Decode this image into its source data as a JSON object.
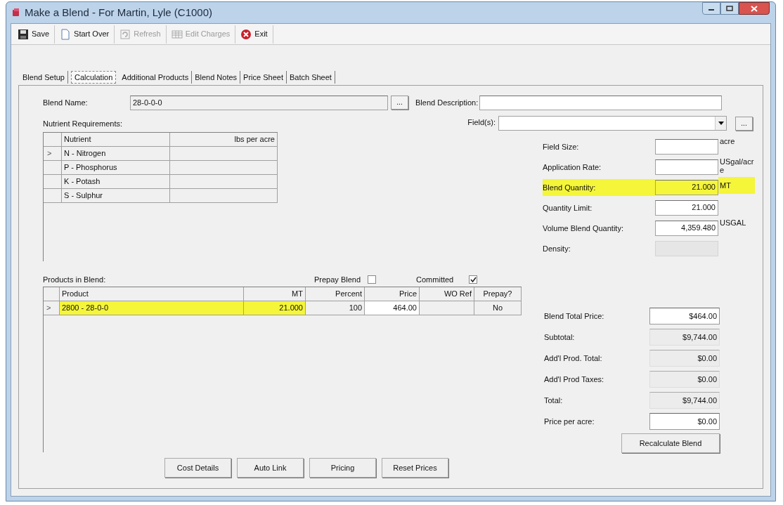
{
  "window": {
    "title": "Make a Blend - For Martin, Lyle (C1000)"
  },
  "toolbar": [
    {
      "kind": "save",
      "label": "Save",
      "disabled": false
    },
    {
      "kind": "new",
      "label": "Start Over",
      "disabled": false
    },
    {
      "kind": "refresh",
      "label": "Refresh",
      "disabled": true
    },
    {
      "kind": "grid",
      "label": "Edit Charges",
      "disabled": true
    },
    {
      "kind": "exit",
      "label": "Exit",
      "disabled": false
    }
  ],
  "tabs": [
    {
      "label": "Blend Setup",
      "selected": false
    },
    {
      "label": "Calculation",
      "selected": true
    },
    {
      "label": "Additional Products",
      "selected": false
    },
    {
      "label": "Blend Notes",
      "selected": false
    },
    {
      "label": "Price Sheet",
      "selected": false
    },
    {
      "label": "Batch Sheet",
      "selected": false
    }
  ],
  "blend_name": {
    "label": "Blend Name:",
    "value": "28-0-0-0",
    "browse": "..."
  },
  "blend_description": {
    "label": "Blend Description:"
  },
  "fields_picker": {
    "label": "Field(s):",
    "browse": "..."
  },
  "nutrient_requirements": {
    "label": "Nutrient Requirements:",
    "columns": [
      "Nutrient",
      "lbs per acre"
    ],
    "rows": [
      {
        "marker": ">",
        "nutrient": "N - Nitrogen"
      },
      {
        "nutrient": "P - Phosphorus"
      },
      {
        "nutrient": "K - Potash"
      },
      {
        "nutrient": "S - Sulphur"
      }
    ]
  },
  "quantities": [
    {
      "label": "Field Size:",
      "unit": "acre",
      "highlighted": false,
      "disabled": false
    },
    {
      "label": "Application Rate:",
      "unit": "USgal/acre",
      "highlighted": false,
      "disabled": false
    },
    {
      "label": "Blend Quantity:",
      "value": "21.000",
      "unit": "MT",
      "highlighted": true,
      "disabled": false
    },
    {
      "label": "Quantity Limit:",
      "value": "21.000",
      "highlighted": false,
      "disabled": false
    },
    {
      "label": "Volume Blend Quantity:",
      "value": "4,359.480",
      "unit": "USGAL",
      "highlighted": false,
      "disabled": false
    },
    {
      "label": "Density:",
      "highlighted": false,
      "disabled": true
    }
  ],
  "products": {
    "label": "Products in Blend:",
    "prepay_blend": {
      "label": "Prepay Blend",
      "checked": false
    },
    "committed": {
      "label": "Committed",
      "checked": true
    },
    "columns": [
      {
        "label": "Product",
        "editable": false
      },
      {
        "label": "MT",
        "editable": false
      },
      {
        "label": "Percent",
        "editable": false
      },
      {
        "label": "Price",
        "editable": true
      },
      {
        "label": "WO Ref",
        "editable": false
      },
      {
        "label": "Prepay?",
        "editable": false
      }
    ],
    "rows": [
      {
        "marker": ">",
        "highlighted": true,
        "cells": [
          "2800 - 28-0-0",
          "21.000",
          "100",
          "464.00",
          "",
          "No"
        ]
      }
    ]
  },
  "bottom_buttons": [
    "Cost Details",
    "Auto Link",
    "Pricing",
    "Reset Prices"
  ],
  "totals": [
    {
      "label": "Blend Total Price:",
      "value": "$464.00",
      "editable": true
    },
    {
      "label": "Subtotal:",
      "value": "$9,744.00",
      "editable": false
    },
    {
      "label": "Add'l Prod. Total:",
      "value": "$0.00",
      "editable": false
    },
    {
      "label": "Add'l Prod Taxes:",
      "value": "$0.00",
      "editable": false
    },
    {
      "label": "Total:",
      "value": "$9,744.00",
      "editable": false
    },
    {
      "label": "Price per acre:",
      "value": "$0.00",
      "editable": true
    }
  ],
  "recalculate_button": "Recalculate Blend"
}
